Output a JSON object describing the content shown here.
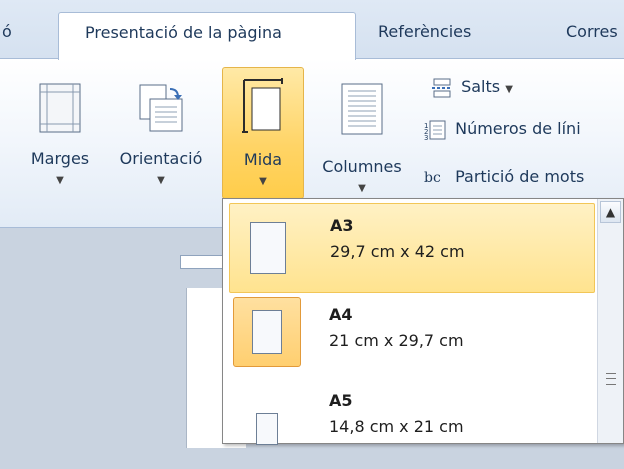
{
  "tabs": {
    "prev_tab_fragment": "ó",
    "active_tab": "Presentació de la pàgina",
    "tab_references": "Referències",
    "tab_mailings_fragment": "Corres"
  },
  "ribbon": {
    "margins_label": "Marges",
    "orientation_label": "Orientació",
    "size_label": "Mida",
    "columns_label": "Columnes",
    "breaks_label": "Salts",
    "line_numbers_label": "Números de líni",
    "hyphenation_label": "Partició de mots",
    "hyphenation_icon_text": "bc"
  },
  "size_menu": {
    "items": [
      {
        "name": "A3",
        "dims": "29,7 cm x 42 cm"
      },
      {
        "name": "A4",
        "dims": "21 cm x 29,7 cm"
      },
      {
        "name": "A5",
        "dims": "14,8 cm x 21 cm"
      }
    ],
    "hovered_item": "A3",
    "selected_item": "A4"
  },
  "colors": {
    "ribbon_text": "#1e395b",
    "hover_gold": "#ffd466",
    "selected_orange": "#e29a3a"
  },
  "icons": [
    "margins-icon",
    "orientation-icon",
    "size-icon",
    "columns-icon",
    "breaks-icon",
    "line-numbers-icon",
    "hyphenation-icon",
    "scroll-up-icon",
    "scroll-grip-icon"
  ]
}
